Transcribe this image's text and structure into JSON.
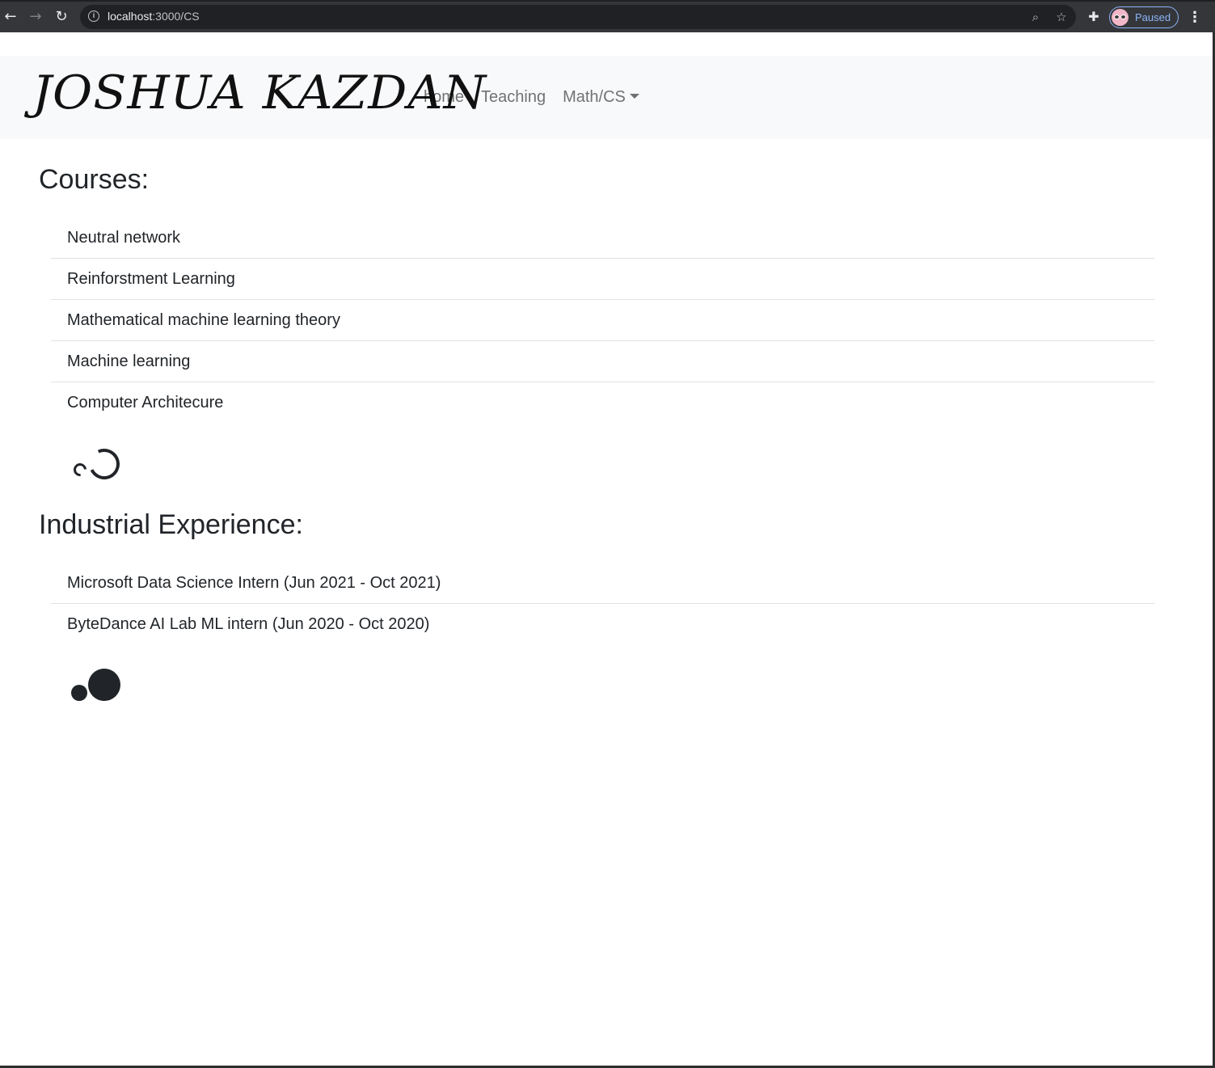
{
  "browser": {
    "url_host": "localhost",
    "url_path": ":3000/CS",
    "profile_label": "Paused",
    "icons": {
      "back": "back-arrow-icon",
      "forward": "forward-arrow-icon",
      "reload": "reload-icon",
      "info": "info-icon",
      "zoom": "zoom-icon",
      "bookmark": "star-icon",
      "extensions": "puzzle-icon",
      "menu": "more-vert-icon"
    }
  },
  "navbar": {
    "brand": "JOSHUA KAZDAN",
    "links": {
      "home": "home",
      "teaching": "Teaching",
      "mathcs": "Math/CS"
    }
  },
  "courses": {
    "title": "Courses:",
    "items": [
      "Neutral network",
      "Reinforstment Learning",
      "Mathematical machine learning theory",
      "Machine learning",
      "Computer Architecure"
    ]
  },
  "experience": {
    "title": "Industrial Experience:",
    "items": [
      "Microsoft Data Science Intern (Jun 2021 - Oct 2021)",
      "ByteDance AI Lab ML intern (Jun 2020 - Oct 2020)"
    ]
  },
  "colors": {
    "chrome_bg": "#35363a",
    "navbar_bg": "#f8f9fa",
    "text": "#212529",
    "nav_link": "rgba(0,0,0,0.55)",
    "divider": "#dee2e6",
    "profile_accent": "#8ab4f8"
  }
}
